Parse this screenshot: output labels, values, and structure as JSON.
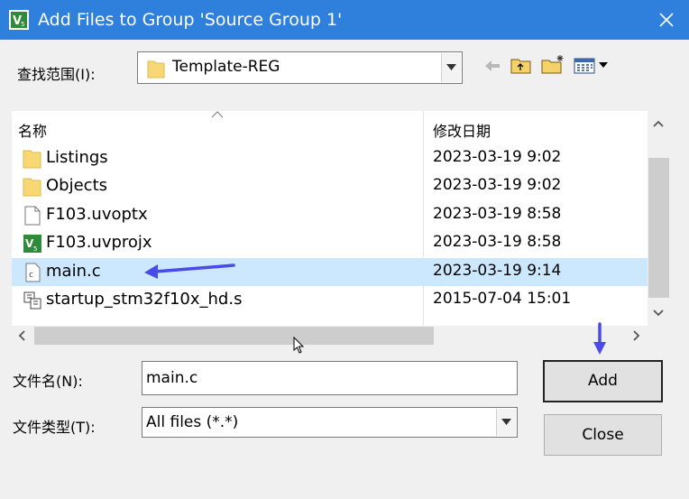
{
  "window": {
    "title": "Add Files to Group 'Source Group 1'",
    "app_icon": "keil-uvision-icon",
    "close_icon": "close-icon",
    "titlebar_color": "#2f7fdc"
  },
  "lookin": {
    "label": "查找范围(I):",
    "value": "Template-REG",
    "tools": [
      "back-arrow-icon",
      "up-folder-icon",
      "new-folder-icon",
      "view-menu-icon"
    ]
  },
  "list": {
    "columns": {
      "name": "名称",
      "date": "修改日期"
    },
    "files": [
      {
        "name": "Listings",
        "date": "2023-03-19 9:02",
        "icon": "folder-icon"
      },
      {
        "name": "Objects",
        "date": "2023-03-19 9:02",
        "icon": "folder-icon"
      },
      {
        "name": "F103.uvoptx",
        "date": "2023-03-19 8:58",
        "icon": "file-icon"
      },
      {
        "name": "F103.uvprojx",
        "date": "2023-03-19 8:58",
        "icon": "uvision-project-icon"
      },
      {
        "name": "main.c",
        "date": "2023-03-19 9:14",
        "icon": "c-file-icon",
        "selected": true
      },
      {
        "name": "startup_stm32f10x_hd.s",
        "date": "2015-07-04 15:01",
        "icon": "asm-file-icon"
      }
    ],
    "selected_color": "#cce8ff"
  },
  "filename": {
    "label": "文件名(N):",
    "value": "main.c"
  },
  "filetype": {
    "label": "文件类型(T):",
    "value": "All files (*.*)"
  },
  "buttons": {
    "add": "Add",
    "close": "Close"
  },
  "annotation_color": "#4a4ae8"
}
